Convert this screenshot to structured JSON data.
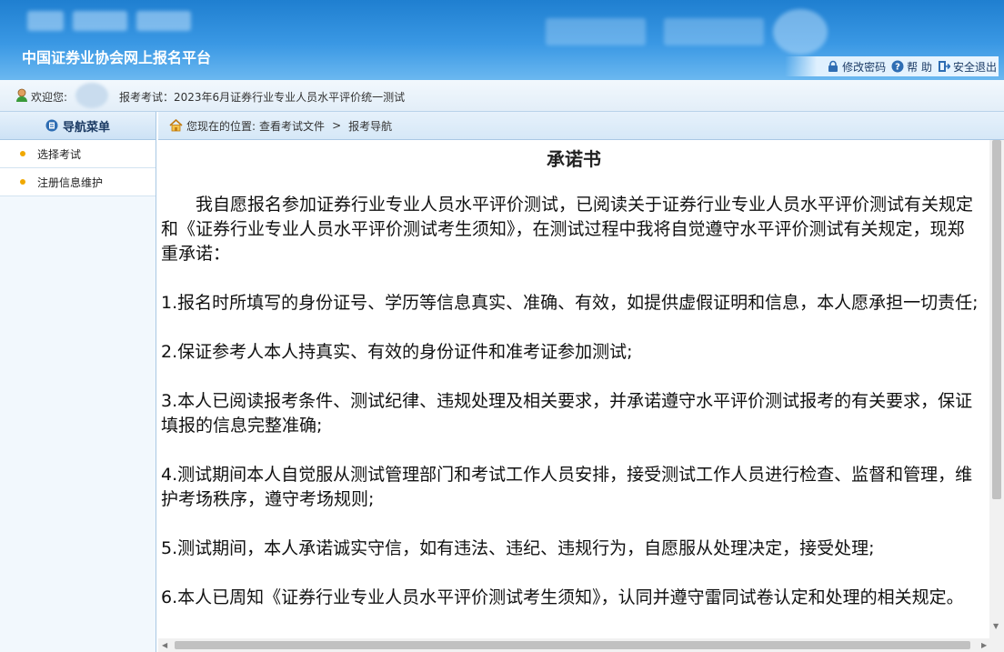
{
  "header": {
    "site_title": "中国证券业协会网上报名平台",
    "links": [
      {
        "label": "修改密码",
        "icon": "lock-icon"
      },
      {
        "label": "帮 助",
        "icon": "help-icon"
      },
      {
        "label": "安全退出",
        "icon": "logout-icon"
      }
    ]
  },
  "welcome": {
    "label": "欢迎您:",
    "exam_text": "报考考试：2023年6月证券行业专业人员水平评价统一测试"
  },
  "sidebar": {
    "title": "导航菜单",
    "items": [
      {
        "label": "选择考试"
      },
      {
        "label": "注册信息维护"
      }
    ]
  },
  "breadcrumb": {
    "prefix": "您现在的位置:",
    "path1": "查看考试文件",
    "separator": ">",
    "path2": "报考导航"
  },
  "document": {
    "title": "承诺书",
    "intro": "我自愿报名参加证券行业专业人员水平评价测试，已阅读关于证券行业专业人员水平评价测试有关规定和《证券行业专业人员水平评价测试考生须知》，在测试过程中我将自觉遵守水平评价测试有关规定，现郑重承诺：",
    "items": [
      "1.报名时所填写的身份证号、学历等信息真实、准确、有效，如提供虚假证明和信息，本人愿承担一切责任;",
      "2.保证参考人本人持真实、有效的身份证件和准考证参加测试;",
      "3.本人已阅读报考条件、测试纪律、违规处理及相关要求，并承诺遵守水平评价测试报考的有关要求，保证填报的信息完整准确;",
      "4.测试期间本人自觉服从测试管理部门和考试工作人员安排，接受测试工作人员进行检查、监督和管理，维护考场秩序，遵守考场规则;",
      "5.测试期间，本人承诺诚实守信，如有违法、违纪、违规行为，自愿服从处理决定，接受处理;",
      "6.本人已周知《证券行业专业人员水平评价测试考生须知》，认同并遵守雷同试卷认定和处理的相关规定。"
    ]
  },
  "colors": {
    "header_blue": "#1f7fd0",
    "bullet": "#f0a800"
  }
}
